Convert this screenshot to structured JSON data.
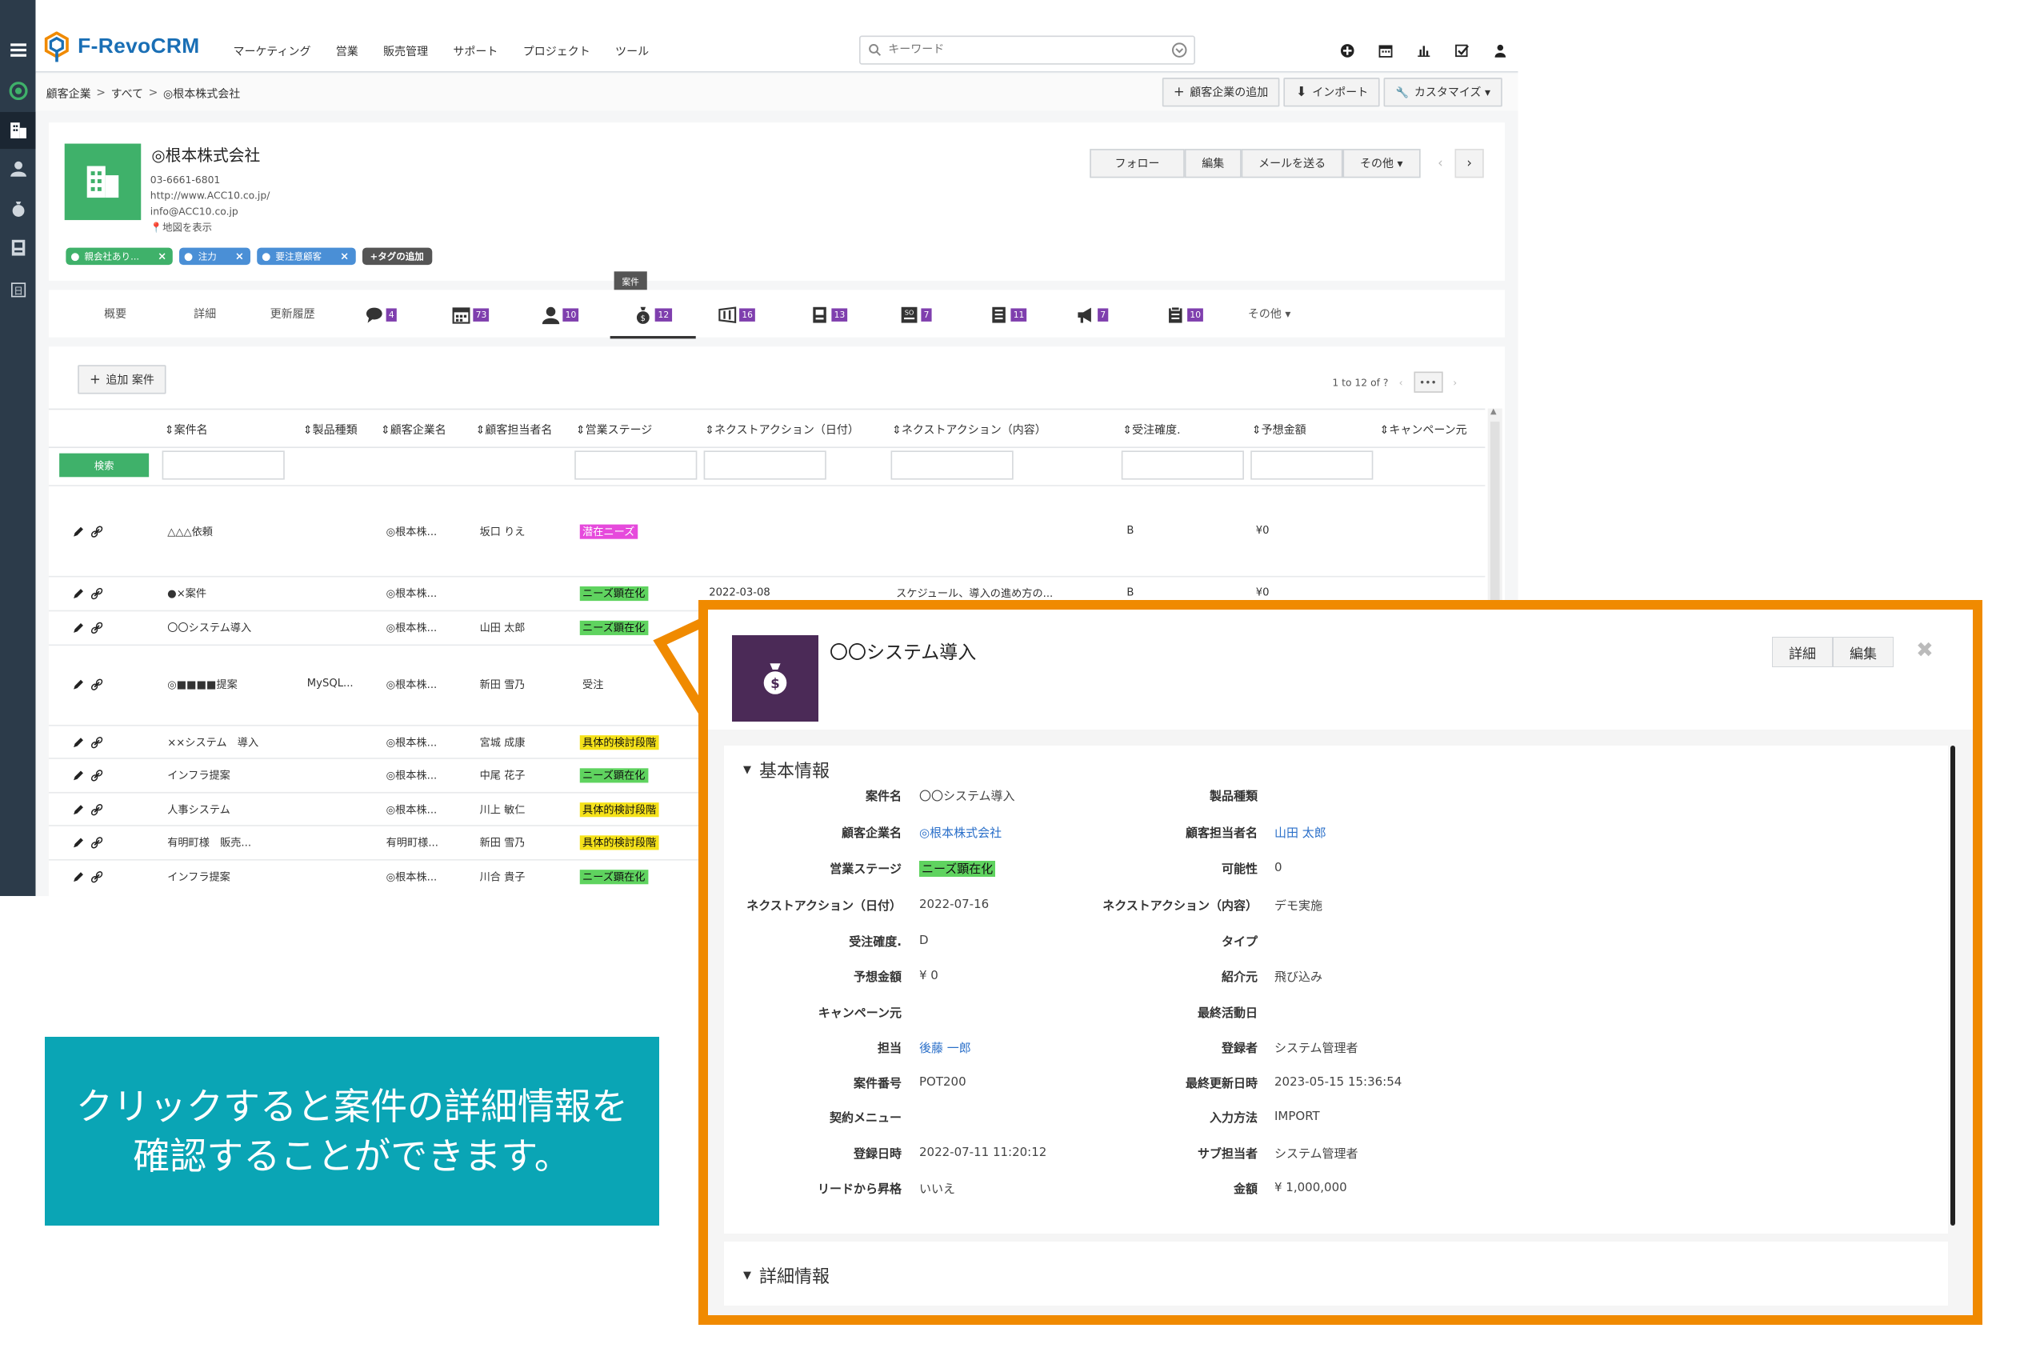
{
  "app": {
    "logo": "F-RevoCRM",
    "nav": [
      "マーケティング",
      "営業",
      "販売管理",
      "サポート",
      "プロジェクト",
      "ツール"
    ],
    "search_placeholder": "キーワード"
  },
  "breadcrumb": {
    "items": [
      "顧客企業",
      "すべて",
      "◎根本株式会社"
    ],
    "sep": ">"
  },
  "crumb_actions": [
    {
      "icon": "+",
      "label": "顧客企業の追加"
    },
    {
      "icon": "⬇",
      "label": "インポート"
    },
    {
      "icon": "🔧",
      "label": "カスタマイズ ▾"
    }
  ],
  "record": {
    "title": "◎根本株式会社",
    "phone": "03-6661-6801",
    "website": "http://www.ACC10.co.jp/",
    "email": "info@ACC10.co.jp",
    "map_link": "地図を表示",
    "actions": [
      "フォロー",
      "編集",
      "メールを送る",
      "その他 ▾"
    ],
    "tags": [
      {
        "label": "親会社あり...",
        "color": "#3fb16a"
      },
      {
        "label": "注力",
        "color": "#4a8fd6"
      },
      {
        "label": "要注意顧客",
        "color": "#4a8fd6"
      }
    ],
    "add_tag": "+タグの追加"
  },
  "tabs": {
    "text_tabs": [
      "概要",
      "詳細",
      "更新履歴"
    ],
    "icon_tabs": [
      {
        "icon": "comment-icon",
        "count": "4"
      },
      {
        "icon": "calendar-icon",
        "count": "73"
      },
      {
        "icon": "contact-icon",
        "count": "10"
      },
      {
        "icon": "moneybag-icon",
        "count": "12"
      },
      {
        "icon": "ticket-icon",
        "count": "16"
      },
      {
        "icon": "doc-icon",
        "count": "13"
      },
      {
        "icon": "so-icon",
        "count": "7"
      },
      {
        "icon": "invoice-icon",
        "count": "11"
      },
      {
        "icon": "megaphone-icon",
        "count": "7"
      },
      {
        "icon": "note-icon",
        "count": "10"
      }
    ],
    "more": "その他 ▾",
    "tooltip": "案件"
  },
  "list": {
    "add_label": "追加 案件",
    "pager_text": "1 to 12  of ?",
    "search_btn": "検索",
    "columns": [
      "案件名",
      "製品種類",
      "顧客企業名",
      "顧客担当者名",
      "営業ステージ",
      "ネクストアクション（日付）",
      "ネクストアクション（内容）",
      "受注確度.",
      "予想金額",
      "キャンペーン元"
    ],
    "rows": [
      {
        "name": "△△△依頼",
        "product": "",
        "account": "◎根本株...",
        "contact": "坂口 りえ",
        "stage": "潜在ニーズ",
        "stage_color": "pink",
        "date": "",
        "content": "",
        "prob": "B",
        "amount": "¥0"
      },
      {
        "name": "●×案件",
        "product": "",
        "account": "◎根本株...",
        "contact": "",
        "stage": "ニーズ顕在化",
        "stage_color": "green",
        "date": "2022-03-08",
        "content": "スケジュール、導入の進め方の...",
        "prob": "B",
        "amount": "¥0"
      },
      {
        "name": "〇〇システム導入",
        "product": "",
        "account": "◎根本株...",
        "contact": "山田 太郎",
        "stage": "ニーズ顕在化",
        "stage_color": "green",
        "date": "",
        "content": "",
        "prob": "",
        "amount": ""
      },
      {
        "name": "◎■■■■提案",
        "product": "MySQL...",
        "account": "◎根本株...",
        "contact": "新田 雪乃",
        "stage": "受注",
        "stage_color": "none",
        "date": "",
        "content": "",
        "prob": "",
        "amount": ""
      },
      {
        "name": "××システム　導入",
        "product": "",
        "account": "◎根本株...",
        "contact": "宮城 成康",
        "stage": "具体的検討段階",
        "stage_color": "yellow",
        "date": "",
        "content": "",
        "prob": "",
        "amount": ""
      },
      {
        "name": "インフラ提案",
        "product": "",
        "account": "◎根本株...",
        "contact": "中尾 花子",
        "stage": "ニーズ顕在化",
        "stage_color": "green",
        "date": "",
        "content": "",
        "prob": "",
        "amount": ""
      },
      {
        "name": "人事システム",
        "product": "",
        "account": "◎根本株...",
        "contact": "川上 敏仁",
        "stage": "具体的検討段階",
        "stage_color": "yellow",
        "date": "",
        "content": "",
        "prob": "",
        "amount": ""
      },
      {
        "name": "有明町様　販売...",
        "product": "",
        "account": "有明町様...",
        "contact": "新田 雪乃",
        "stage": "具体的検討段階",
        "stage_color": "yellow",
        "date": "",
        "content": "",
        "prob": "",
        "amount": ""
      },
      {
        "name": "インフラ提案",
        "product": "",
        "account": "◎根本株...",
        "contact": "川合 貴子",
        "stage": "ニーズ顕在化",
        "stage_color": "green",
        "date": "",
        "content": "",
        "prob": "",
        "amount": ""
      }
    ]
  },
  "callout": {
    "text": "クリックすると案件の詳細情報を確認することができます。"
  },
  "popup": {
    "title": "〇〇システム導入",
    "actions": [
      "詳細",
      "編集"
    ],
    "close": "✖",
    "section_basic": "基本情報",
    "section_detail": "詳細情報",
    "left_fields": [
      {
        "label": "案件名",
        "value": "〇〇システム導入"
      },
      {
        "label": "顧客企業名",
        "value": "◎根本株式会社",
        "link": true
      },
      {
        "label": "営業ステージ",
        "value": "ニーズ顕在化",
        "stage": true
      },
      {
        "label": "ネクストアクション（日付）",
        "value": "2022-07-16"
      },
      {
        "label": "受注確度.",
        "value": "D"
      },
      {
        "label": "予想金額",
        "value": "¥ 0"
      },
      {
        "label": "キャンペーン元",
        "value": ""
      },
      {
        "label": "担当",
        "value": "後藤 一郎",
        "link": true
      },
      {
        "label": "案件番号",
        "value": "POT200"
      },
      {
        "label": "契約メニュー",
        "value": ""
      },
      {
        "label": "登録日時",
        "value": "2022-07-11 11:20:12"
      },
      {
        "label": "リードから昇格",
        "value": "いいえ"
      }
    ],
    "right_fields": [
      {
        "label": "製品種類",
        "value": ""
      },
      {
        "label": "顧客担当者名",
        "value": "山田 太郎",
        "link": true
      },
      {
        "label": "可能性",
        "value": "0"
      },
      {
        "label": "ネクストアクション（内容）",
        "value": "デモ実施"
      },
      {
        "label": "タイプ",
        "value": ""
      },
      {
        "label": "紹介元",
        "value": "飛び込み"
      },
      {
        "label": "最終活動日",
        "value": ""
      },
      {
        "label": "登録者",
        "value": "システム管理者"
      },
      {
        "label": "最終更新日時",
        "value": "2023-05-15 15:36:54"
      },
      {
        "label": "入力方法",
        "value": "IMPORT"
      },
      {
        "label": "サブ担当者",
        "value": "システム管理者"
      },
      {
        "label": "金額",
        "value": "¥ 1,000,000"
      }
    ]
  }
}
